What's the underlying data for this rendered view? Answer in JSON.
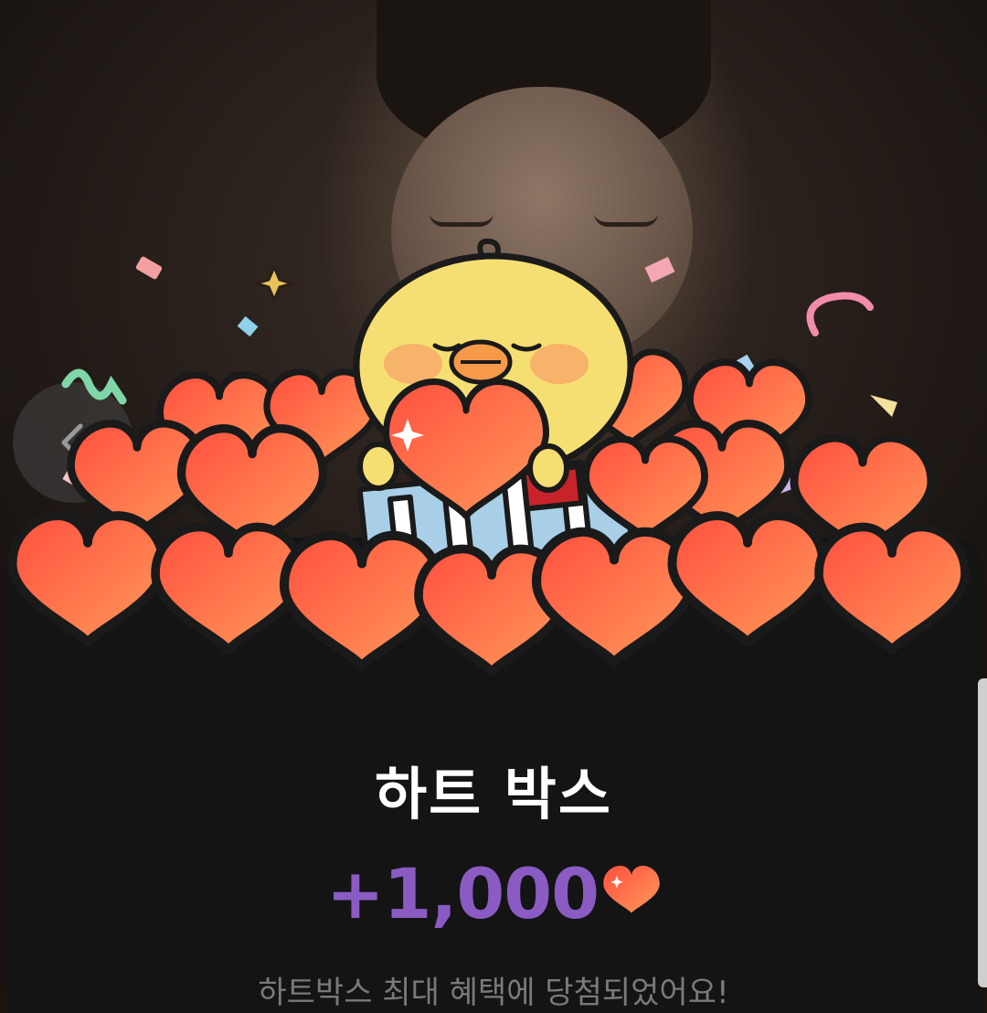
{
  "popup": {
    "title": "하트 박스",
    "reward_amount": "+1,000",
    "reward_icon": "heart-icon",
    "subtitle": "하트박스 최대 혜택에 당첨되었어요!"
  },
  "navigation": {
    "back_icon": "chevron-left-icon"
  },
  "colors": {
    "panel_background": "#141414",
    "title": "#ffffff",
    "reward_amount": "#8b5bc4",
    "heart_gradient_start": "#ff4f3f",
    "heart_gradient_end": "#ff9a5a",
    "chick": "#f6df72"
  }
}
